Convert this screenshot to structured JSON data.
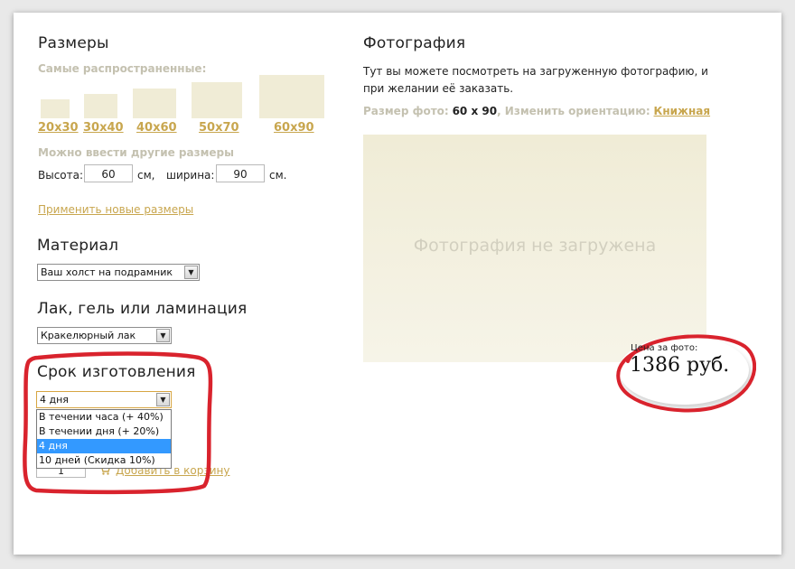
{
  "sizes": {
    "title": "Размеры",
    "common_label": "Самые распространенные:",
    "options": [
      "20x30",
      "30x40",
      "40x60",
      "50x70",
      "60x90"
    ],
    "custom_label": "Можно ввести другие размеры",
    "height_label": "Высота:",
    "height_value": "60",
    "unit1": "см,",
    "width_label": "ширина:",
    "width_value": "90",
    "unit2": "см.",
    "apply_link": "Применить новые размеры"
  },
  "material": {
    "title": "Материал",
    "selected": "Ваш холст на подрамник"
  },
  "finish": {
    "title": "Лак, гель или ламинация",
    "selected": "Кракелюрный лак"
  },
  "deadline": {
    "title": "Срок изготовления",
    "selected": "4 дня",
    "options": [
      "В течении часа (+ 40%)",
      "В течении дня (+ 20%)",
      "4 дня",
      "10 дней (Скидка 10%)"
    ],
    "highlighted_index": 2
  },
  "cart": {
    "quantity": "1",
    "add_label": "Добавить в корзину",
    "icon": "cart-icon"
  },
  "photo": {
    "title": "Фотография",
    "description": "Тут вы можете посмотреть на загруженную фотографию, и при желании её заказать.",
    "size_label": "Размер фото:",
    "size_value": "60 х 90",
    "orientation_label": ", Изменить ориентацию:",
    "orientation_value": "Книжная",
    "placeholder": "Фотография не загружена"
  },
  "price": {
    "label": "Цена за фото:",
    "value": "1386 руб."
  },
  "colors": {
    "accent_gold": "#c8a64e",
    "muted_text": "#c4c1b0",
    "photo_bg": "#f0ecd6",
    "annotation_red": "#d9232d",
    "selection_blue": "#3399ff"
  }
}
